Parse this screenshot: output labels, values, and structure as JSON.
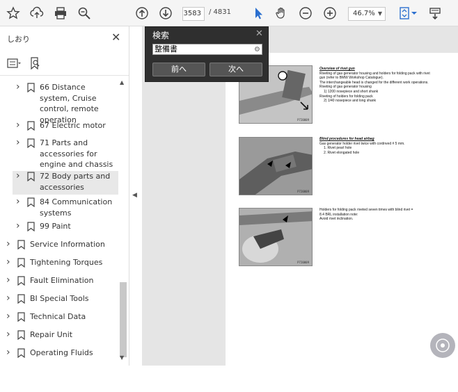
{
  "toolbar": {
    "icons": [
      "bookmark-star-icon",
      "upload-icon",
      "print-icon",
      "zoom-search-icon",
      "prev-page-icon",
      "next-page-icon",
      "select-cursor-icon",
      "hand-icon",
      "zoom-out-icon",
      "zoom-in-icon",
      "fit-page-icon",
      "scroll-mode-icon"
    ],
    "page_current": "3583",
    "page_total": "/ 4831",
    "zoom": "46.7%",
    "colors": {
      "accent": "#2b6fcf"
    }
  },
  "panel": {
    "title": "しおり",
    "close": "✕",
    "items": [
      {
        "label": "66 Distance system, Cruise control, remote operation",
        "level": 1,
        "selected": false
      },
      {
        "label": "67 Electric motor",
        "level": 1,
        "selected": false
      },
      {
        "label": "71 Parts and accessories for engine and chassis",
        "level": 1,
        "selected": false
      },
      {
        "label": "72 Body parts and accessories",
        "level": 1,
        "selected": true
      },
      {
        "label": "84 Communication systems",
        "level": 1,
        "selected": false
      },
      {
        "label": "99 Paint",
        "level": 1,
        "selected": false
      },
      {
        "label": "Service Information",
        "level": 0,
        "selected": false
      },
      {
        "label": "Tightening Torques",
        "level": 0,
        "selected": false
      },
      {
        "label": "Fault Elimination",
        "level": 0,
        "selected": false
      },
      {
        "label": "BI Special Tools",
        "level": 0,
        "selected": false
      },
      {
        "label": "Technical Data",
        "level": 0,
        "selected": false
      },
      {
        "label": "Repair Unit",
        "level": 0,
        "selected": false
      },
      {
        "label": "Operating Fluids",
        "level": 0,
        "selected": false
      }
    ]
  },
  "search": {
    "title": "検索",
    "close": "✕",
    "value": "整備書",
    "prev_label": "前へ",
    "next_label": "次へ"
  },
  "document": {
    "sections": [
      {
        "heading": "Overview of rivet gun",
        "lines": [
          "Riveting of gas generator housing and holders for folding pack with rivet",
          "gun (refer to BMW Workshop Catalogue).",
          "The interchangeable head is changed for the different work operations.",
          "Riveting of gas generator housing"
        ],
        "items": [
          "1) 1200 nosepiece and short shank",
          "Riveting of holders for folding pack",
          "2) 1/40 nosepiece and long shank"
        ],
        "photo_code": "P720009"
      },
      {
        "heading": "Blind procedures for head airbag",
        "lines": [
          "Gas generator holder rivet twice with cordnved # 5 mm."
        ],
        "items": [
          "1. Rivet pearl hole",
          "2. Rivet elongated hole"
        ],
        "photo_code": "P720009"
      },
      {
        "heading": "",
        "lines": [
          "Holders for folding pack riveted seven times with blind rivet =",
          "8.4 BRL installation note:",
          "Avoid rivet inclination."
        ],
        "items": [],
        "photo_code": "P720009"
      }
    ]
  }
}
